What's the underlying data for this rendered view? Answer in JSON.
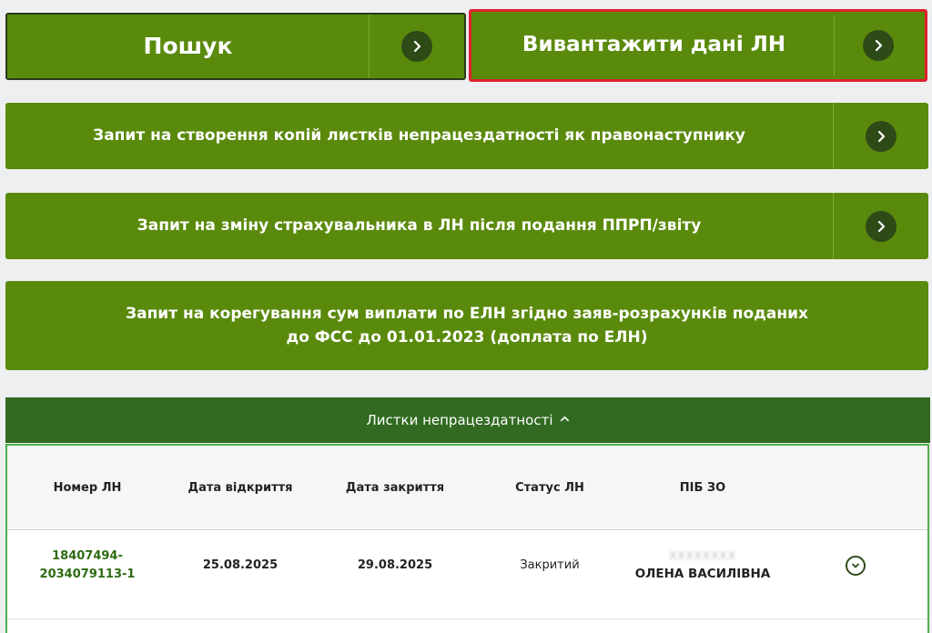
{
  "buttons": {
    "search": "Пошук",
    "export": "Вивантажити дані ЛН",
    "copies_request": "Запит на створення копій листків непрацездатності як правонаступнику",
    "insurer_change": "Запит на зміну страхувальника в ЛН після подання ППРП/звіту",
    "correction_line1": "Запит на корегування сум виплати по ЕЛН згідно заяв-розрахунків поданих",
    "correction_line2": "до ФСС до 01.01.2023 (доплата по ЕЛН)"
  },
  "section": {
    "title": "Листки непрацездатності"
  },
  "table": {
    "headers": [
      "Номер ЛН",
      "Дата відкриття",
      "Дата закриття",
      "Статус ЛН",
      "ПІБ ЗО"
    ],
    "rows": [
      {
        "number_line1": "18407494-",
        "number_line2": "2034079113-1",
        "opened": "25.08.2025",
        "closed": "29.08.2025",
        "status": "Закритий",
        "name_redacted": "ХХХХХХХХ",
        "name": "ОЛЕНА ВАСИЛІВНА"
      }
    ]
  },
  "colors": {
    "button_green": "#5a8a0c",
    "section_green": "#326a21",
    "highlight_red": "#e0202e",
    "chevron_dark": "#2e4a16"
  },
  "icons": {
    "arrow": "chevron-right-icon",
    "caret": "chevron-up-icon",
    "expand": "chevron-down-circle-icon"
  }
}
